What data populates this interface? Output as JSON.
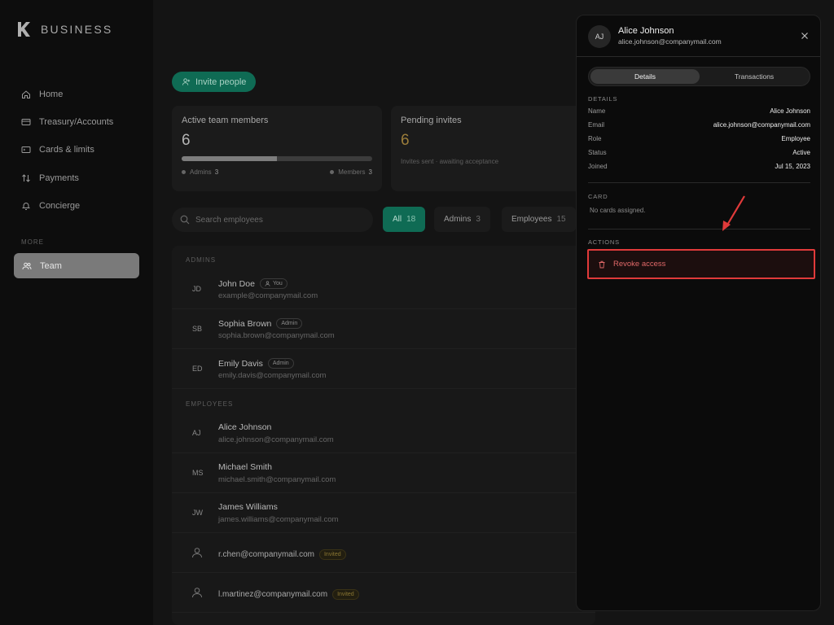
{
  "brand": {
    "name": "BUSINESS"
  },
  "sidebar": {
    "items": [
      {
        "label": "Home",
        "icon": "home-icon"
      },
      {
        "label": "Treasury/Accounts",
        "icon": "card-icon"
      },
      {
        "label": "Cards & limits",
        "icon": "terminal-card-icon"
      },
      {
        "label": "Payments",
        "icon": "transfer-arrows-icon"
      },
      {
        "label": "Concierge",
        "icon": "bell-icon"
      }
    ],
    "more_label": "MORE",
    "team_label": "Team"
  },
  "main": {
    "invite_label": "Invite people",
    "active_card": {
      "title": "Active team members",
      "value": "6",
      "progress_fraction": 0.5,
      "admins_label": "Admins",
      "admins_count": "3",
      "members_label": "Members",
      "members_count": "3"
    },
    "pending_card": {
      "title": "Pending invites",
      "value": "6",
      "subtitle": "Invites sent · awaiting acceptance"
    },
    "search_placeholder": "Search employees",
    "filters": [
      {
        "label": "All",
        "count": "18"
      },
      {
        "label": "Admins",
        "count": "3"
      },
      {
        "label": "Employees",
        "count": "15"
      }
    ],
    "admins_label": "ADMINS",
    "employees_label": "EMPLOYEES",
    "admins": [
      {
        "initials": "JD",
        "name": "John Doe",
        "tag": "You",
        "email": "example@companymail.com"
      },
      {
        "initials": "SB",
        "name": "Sophia Brown",
        "tag": "Admin",
        "email": "sophia.brown@companymail.com"
      },
      {
        "initials": "ED",
        "name": "Emily Davis",
        "tag": "Admin",
        "email": "emily.davis@companymail.com"
      }
    ],
    "employees": [
      {
        "initials": "AJ",
        "name": "Alice Johnson",
        "email": "alice.johnson@companymail.com"
      },
      {
        "initials": "MS",
        "name": "Michael Smith",
        "email": "michael.smith@companymail.com"
      },
      {
        "initials": "JW",
        "name": "James Williams",
        "email": "james.williams@companymail.com"
      }
    ],
    "invited": [
      {
        "email": "r.chen@companymail.com",
        "tag": "Invited"
      },
      {
        "email": "l.martinez@companymail.com",
        "tag": "Invited"
      }
    ]
  },
  "panel": {
    "initials": "AJ",
    "name": "Alice Johnson",
    "email": "alice.johnson@companymail.com",
    "tabs": [
      "Details",
      "Transactions"
    ],
    "details_label": "DETAILS",
    "fields": [
      {
        "key": "Name",
        "value": "Alice Johnson"
      },
      {
        "key": "Email",
        "value": "alice.johnson@companymail.com"
      },
      {
        "key": "Role",
        "value": "Employee"
      },
      {
        "key": "Status",
        "value": "Active"
      },
      {
        "key": "Joined",
        "value": "Jul 15, 2023"
      }
    ],
    "card_label": "CARD",
    "no_cards": "No cards assigned.",
    "actions_label": "ACTIONS",
    "revoke_label": "Revoke access"
  },
  "colors": {
    "accent": "#0f6b54",
    "danger": "#e03a3a",
    "pending": "#9b7d3a"
  }
}
